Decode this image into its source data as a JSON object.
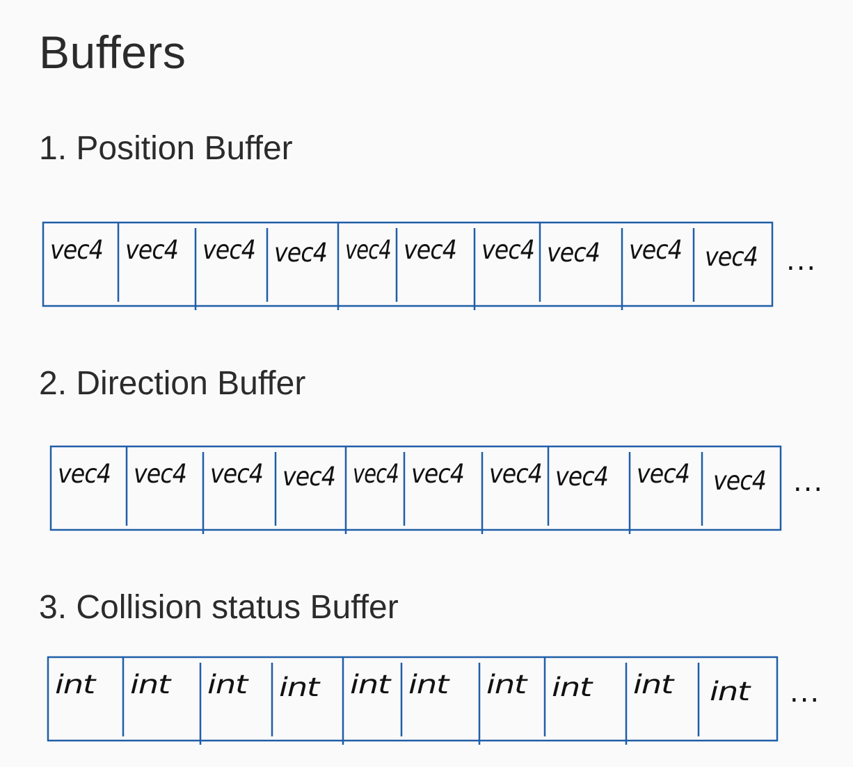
{
  "title": "Buffers",
  "colors": {
    "background": "#fafafa",
    "buffer_outline": "#1f5ea8",
    "text": "#2b2b2b",
    "handwriting": "#111111"
  },
  "buffers": [
    {
      "heading": "1. Position Buffer",
      "cells": [
        "vec4",
        "vec4",
        "vec4",
        "vec4",
        "vec4",
        "vec4",
        "vec4",
        "vec4",
        "vec4",
        "vec4"
      ],
      "continuation": "..."
    },
    {
      "heading": "2. Direction Buffer",
      "cells": [
        "vec4",
        "vec4",
        "vec4",
        "vec4",
        "vec4",
        "vec4",
        "vec4",
        "vec4",
        "vec4",
        "vec4"
      ],
      "continuation": "..."
    },
    {
      "heading": "3. Collision status Buffer",
      "cells": [
        "int",
        "int",
        "int",
        "int",
        "int",
        "int",
        "int",
        "int",
        "int",
        "int"
      ],
      "continuation": "..."
    }
  ]
}
